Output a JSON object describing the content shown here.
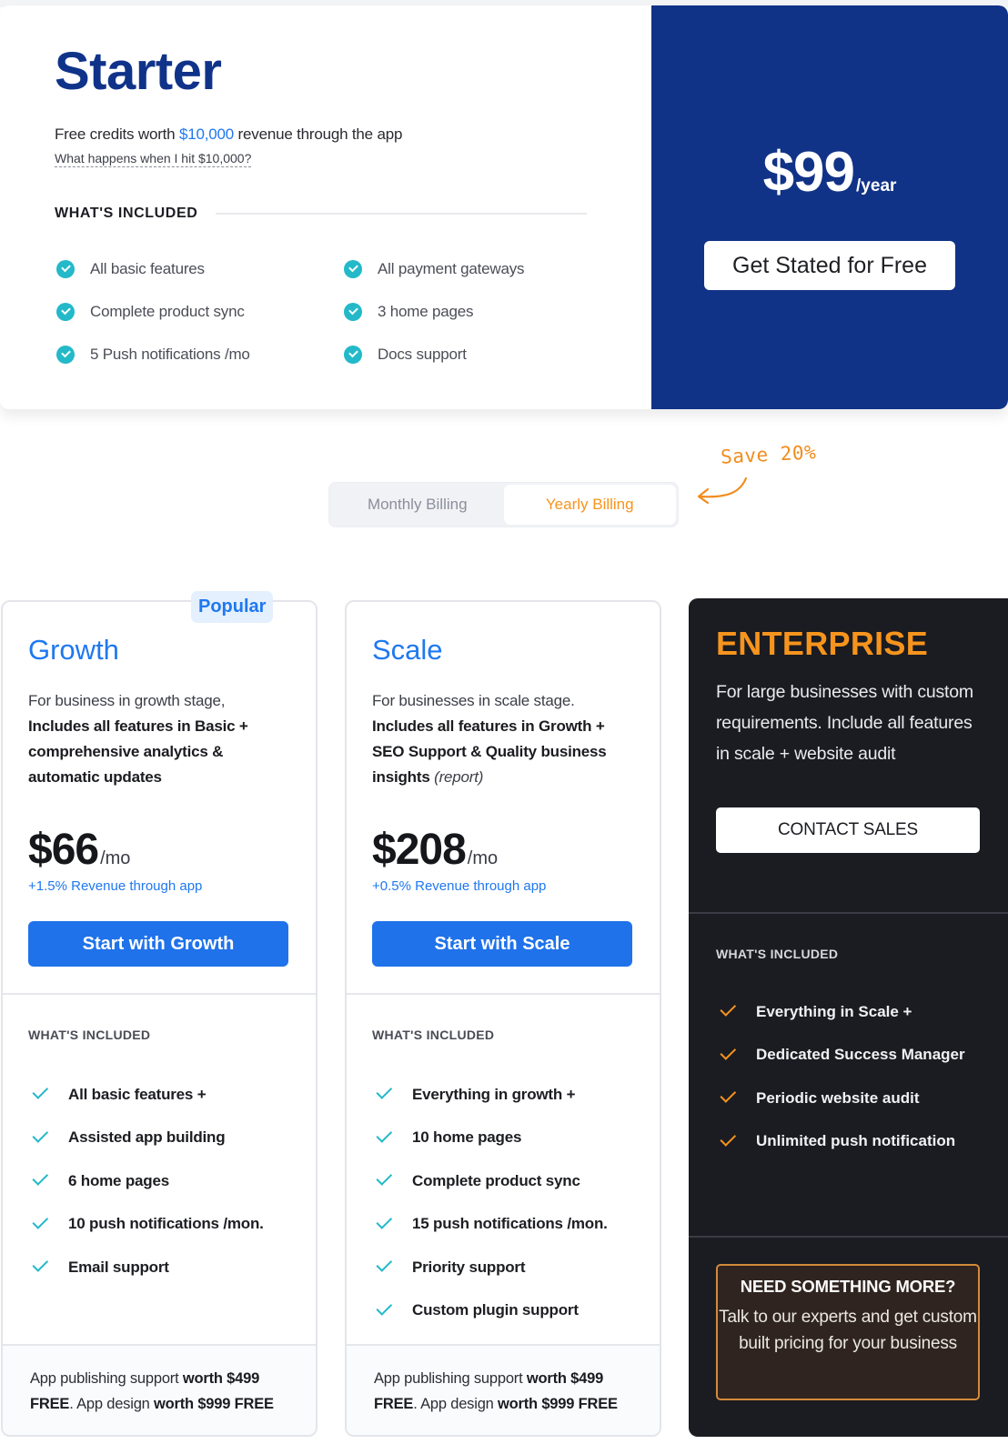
{
  "starter": {
    "title": "Starter",
    "subtitle_pre": "Free credits worth ",
    "subtitle_highlight": "$10,000",
    "subtitle_post": " revenue through the app",
    "link": "What happens when I hit $10,000?",
    "included_label": "WHAT'S INCLUDED",
    "features": [
      "All basic features",
      "All payment gateways",
      "Complete product sync",
      "3 home pages",
      "5 Push notifications /mo",
      "Docs support"
    ],
    "price": "$99",
    "price_unit": "/year",
    "cta": "Get Stated for Free"
  },
  "billing": {
    "monthly": "Monthly Billing",
    "yearly": "Yearly Billing",
    "active": "yearly",
    "save_note": "Save 20%"
  },
  "plans": {
    "growth": {
      "badge": "Popular",
      "name": "Growth",
      "desc_plain": "For business in growth stage,",
      "desc_bold": "Includes all features in Basic + comprehensive analytics & automatic updates",
      "price": "$66",
      "price_unit": "/mo",
      "revenue": "+1.5% Revenue through app",
      "cta": "Start with Growth",
      "included_label": "WHAT'S INCLUDED",
      "features": [
        "All basic features +",
        "Assisted app building",
        "6 home pages",
        "10 push notifications /mon.",
        "Email support"
      ],
      "footer": {
        "t1": "App publishing support ",
        "b1": "worth $499 FREE",
        "t2": ". App design ",
        "b2": "worth $999 FREE"
      }
    },
    "scale": {
      "name": "Scale",
      "desc_plain": "For businesses in scale stage.",
      "desc_bold": "Includes all features in Growth + SEO Support & Quality business insights",
      "desc_italic": "(report)",
      "price": "$208",
      "price_unit": "/mo",
      "revenue": "+0.5% Revenue through app",
      "cta": "Start with Scale",
      "included_label": "WHAT'S INCLUDED",
      "features": [
        "Everything in growth +",
        "10 home pages",
        "Complete product sync",
        "15 push notifications /mon.",
        "Priority support",
        "Custom plugin support"
      ],
      "footer": {
        "t1": "App publishing support ",
        "b1": "worth $499 FREE",
        "t2": ". App design ",
        "b2": "worth $999 FREE"
      }
    },
    "enterprise": {
      "name": "ENTERPRISE",
      "desc": "For large businesses with custom requirements. Include all features in scale + website audit",
      "cta": "CONTACT SALES",
      "included_label": "WHAT'S INCLUDED",
      "features": [
        "Everything in Scale +",
        "Dedicated Success Manager",
        "Periodic website audit",
        "Unlimited push notification"
      ],
      "more_title": "NEED SOMETHING MORE?",
      "more_text": "Talk to our experts and get custom built pricing for your business"
    }
  },
  "colors": {
    "brand_navy": "#113387",
    "accent_blue": "#1f78f0",
    "accent_orange": "#f7941d",
    "check_teal": "#23b9c9",
    "enterprise_bg": "#1b1c21"
  }
}
